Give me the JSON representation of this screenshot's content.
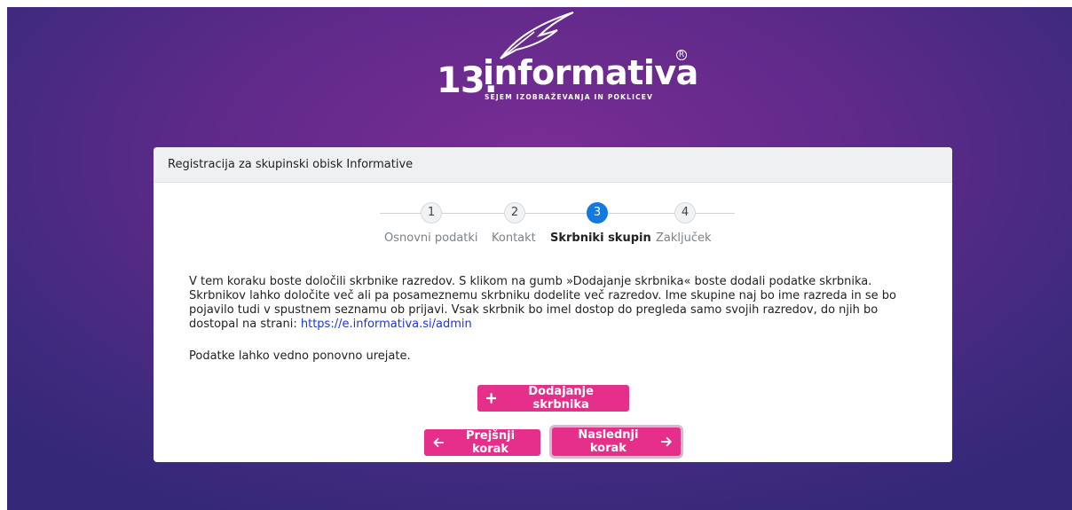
{
  "logo": {
    "number": "13.",
    "word": "informativa",
    "registered": "R",
    "tagline": "SEJEM IZOBRAŽEVANJA IN POKLICEV"
  },
  "card": {
    "title": "Registracija za skupinski obisk Informative"
  },
  "stepper": {
    "steps": [
      {
        "number": "1",
        "label": "Osnovni podatki",
        "active": false
      },
      {
        "number": "2",
        "label": "Kontakt",
        "active": false
      },
      {
        "number": "3",
        "label": "Skrbniki skupin",
        "active": true
      },
      {
        "number": "4",
        "label": "Zaključek",
        "active": false
      }
    ]
  },
  "content": {
    "description": "V tem koraku boste določili skrbnike razredov. S klikom na gumb »Dodajanje skrbnika« boste dodali podatke skrbnika. Skrbnikov lahko določite več ali pa posameznemu skrbniku dodelite več razredov. Ime skupine naj bo ime razreda in se bo pojavilo tudi v spustnem seznamu ob prijavi. Vsak skrbnik bo imel dostop do pregleda samo svojih razredov, do njih bo dostopal na strani: ",
    "link": "https://e.informativa.si/admin",
    "note": "Podatke lahko vedno ponovno urejate."
  },
  "buttons": {
    "add_label": "Dodajanje skrbnika",
    "prev_label": "Prejšnji korak",
    "next_label": "Naslednji korak"
  },
  "colors": {
    "accent": "#e62f8a",
    "active_step": "#1279e0",
    "link": "#1b36d6"
  },
  "icons": [
    "feather-icon",
    "plus-icon",
    "arrow-left-icon",
    "arrow-right-icon"
  ]
}
